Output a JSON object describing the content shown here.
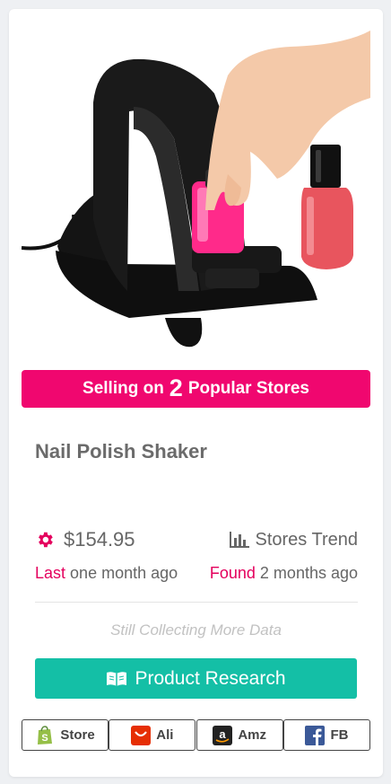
{
  "banner": {
    "prefix": "Selling on",
    "count": "2",
    "suffix": "Popular Stores"
  },
  "product": {
    "title": "Nail Polish Shaker",
    "price": "$154.95",
    "trend_label": "Stores Trend",
    "last_label": "Last",
    "last_value": "one month ago",
    "found_label": "Found",
    "found_value": "2 months ago",
    "status_note": "Still Collecting More Data"
  },
  "actions": {
    "research_label": "Product Research",
    "store_buttons": [
      {
        "label": "Store",
        "icon": "shopify-icon"
      },
      {
        "label": "Ali",
        "icon": "aliexpress-icon"
      },
      {
        "label": "Amz",
        "icon": "amazon-icon"
      },
      {
        "label": "FB",
        "icon": "facebook-icon"
      }
    ]
  },
  "colors": {
    "accent_pink": "#f0076f",
    "accent_teal": "#14bfa6",
    "text_gray": "#666666"
  }
}
